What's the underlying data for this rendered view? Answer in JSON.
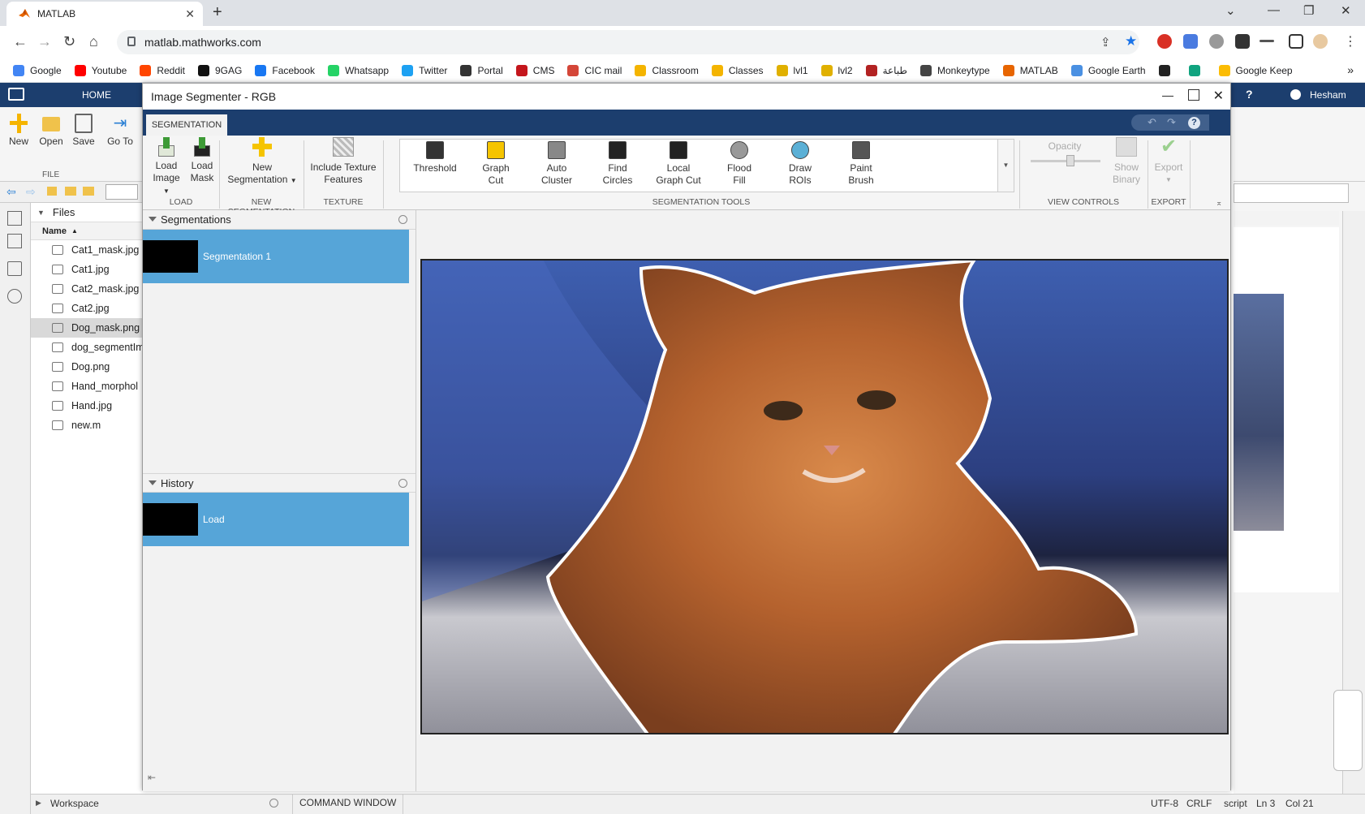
{
  "browser": {
    "tab_title": "MATLAB",
    "url": "matlab.mathworks.com",
    "bookmarks": [
      {
        "label": "Google",
        "color": "#4285f4"
      },
      {
        "label": "Youtube",
        "color": "#ff0000"
      },
      {
        "label": "Reddit",
        "color": "#ff4500"
      },
      {
        "label": "9GAG",
        "color": "#111111"
      },
      {
        "label": "Facebook",
        "color": "#1877f2"
      },
      {
        "label": "Whatsapp",
        "color": "#25d366"
      },
      {
        "label": "Twitter",
        "color": "#1da1f2"
      },
      {
        "label": "Portal",
        "color": "#333333"
      },
      {
        "label": "CMS",
        "color": "#c4161c"
      },
      {
        "label": "CIC mail",
        "color": "#d44638"
      },
      {
        "label": "Classroom",
        "color": "#f4b400"
      },
      {
        "label": "Classes",
        "color": "#f4b400"
      },
      {
        "label": "lvl1",
        "color": "#e0b000"
      },
      {
        "label": "lvl2",
        "color": "#e0b000"
      },
      {
        "label": "طباعة",
        "color": "#b22222"
      },
      {
        "label": "Monkeytype",
        "color": "#444444"
      },
      {
        "label": "MATLAB",
        "color": "#e76500"
      },
      {
        "label": "Google Earth",
        "color": "#4a90e2"
      },
      {
        "label": "",
        "color": "#222222"
      },
      {
        "label": "",
        "color": "#10a37f"
      },
      {
        "label": "Google Keep",
        "color": "#fbbc04"
      }
    ],
    "more_bookmarks": "»"
  },
  "matlab": {
    "home_tab": "HOME",
    "user": "Hesham",
    "file_buttons": [
      {
        "label": "New"
      },
      {
        "label": "Open"
      },
      {
        "label": "Save"
      },
      {
        "label": "Go To"
      }
    ],
    "file_group": "FILE",
    "files_panel_title": "Files",
    "name_column": "Name",
    "files": [
      {
        "name": "Cat1_mask.jpg",
        "selected": false
      },
      {
        "name": "Cat1.jpg",
        "selected": false
      },
      {
        "name": "Cat2_mask.jpg",
        "selected": false
      },
      {
        "name": "Cat2.jpg",
        "selected": false
      },
      {
        "name": "Dog_mask.png",
        "selected": true
      },
      {
        "name": "dog_segmentIm",
        "selected": false
      },
      {
        "name": "Dog.png",
        "selected": false
      },
      {
        "name": "Hand_morphol",
        "selected": false
      },
      {
        "name": "Hand.jpg",
        "selected": false
      },
      {
        "name": "new.m",
        "selected": false
      }
    ],
    "workspace_label": "Workspace",
    "command_window_label": "COMMAND WINDOW",
    "status": {
      "encoding": "UTF-8",
      "eol": "CRLF",
      "type": "script",
      "line": "Ln 3",
      "col": "Col 21"
    }
  },
  "segmenter": {
    "title": "Image Segmenter - RGB",
    "tab": "SEGMENTATION",
    "load_buttons": {
      "load_image": [
        "Load",
        "Image"
      ],
      "load_mask": [
        "Load",
        "Mask"
      ]
    },
    "new_segmentation": [
      "New",
      "Segmentation"
    ],
    "texture_button": [
      "Include Texture",
      "Features"
    ],
    "tools": [
      {
        "l1": "Threshold",
        "l2": ""
      },
      {
        "l1": "Graph",
        "l2": "Cut"
      },
      {
        "l1": "Auto",
        "l2": "Cluster"
      },
      {
        "l1": "Find",
        "l2": "Circles"
      },
      {
        "l1": "Local",
        "l2": "Graph Cut"
      },
      {
        "l1": "Flood",
        "l2": "Fill"
      },
      {
        "l1": "Draw",
        "l2": "ROIs"
      },
      {
        "l1": "Paint",
        "l2": "Brush"
      }
    ],
    "view_controls": {
      "opacity": "Opacity",
      "show_binary": [
        "Show",
        "Binary"
      ]
    },
    "export": "Export",
    "groups": {
      "load": "LOAD",
      "new_seg": "NEW SEGMENTATION",
      "texture": "TEXTURE",
      "tools": "SEGMENTATION TOOLS",
      "view": "VIEW CONTROLS",
      "export": "EXPORT"
    },
    "segmentations_title": "Segmentations",
    "segmentations": [
      "Segmentation 1"
    ],
    "history_title": "History",
    "history": [
      "Load"
    ]
  }
}
